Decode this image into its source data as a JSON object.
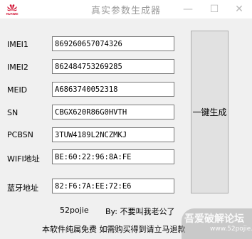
{
  "window": {
    "title": "真实参数生成器",
    "min_glyph": "—",
    "max_glyph": "☐",
    "close_glyph": "✕"
  },
  "app_icon": {
    "name": "huawei-logo-icon",
    "caption": "HUAWEI",
    "color": "#cf0a2c"
  },
  "fields": [
    {
      "label": "IMEI1",
      "value": "869260657074326"
    },
    {
      "label": "IMEI2",
      "value": "862484753269285"
    },
    {
      "label": "MEID",
      "value": "A6863740052318"
    },
    {
      "label": "SN",
      "value": "CBGX620R86G0HVTH"
    },
    {
      "label": "PCBSN",
      "value": "3TUW4189L2NCZMKJ"
    },
    {
      "label": "WIFI地址",
      "value": "BE:60:22:96:8A:FE"
    },
    {
      "label": "蓝牙地址",
      "value": "82:F6:7A:EE:72:E6"
    }
  ],
  "generate_button": {
    "label": "一键生成"
  },
  "footer": {
    "site": "52pojie",
    "author": "By: 不要叫我老公了",
    "notice": "本软件纯属免费 如需购买得到请立马退款"
  },
  "watermark": {
    "text": "吾爱破解论坛",
    "url": "www.52pojie.cn"
  }
}
